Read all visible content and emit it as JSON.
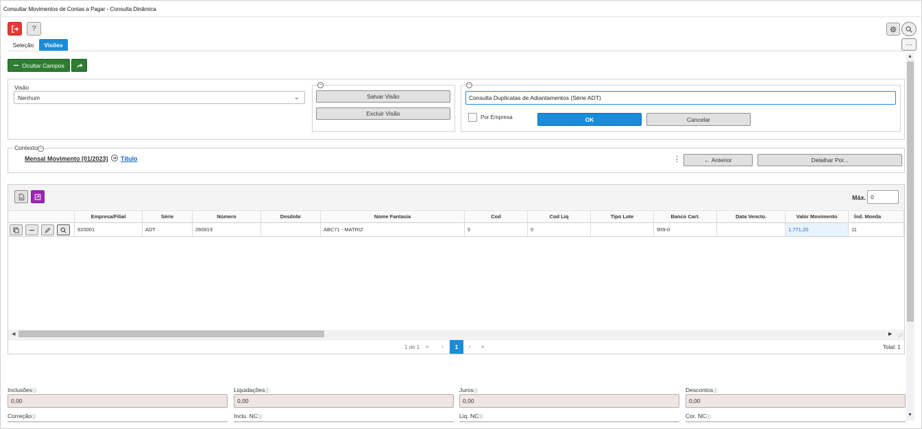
{
  "window": {
    "title": "Consultar Movimentos de Contas a Pagar - Consulta Dinâmica"
  },
  "toolbar": {
    "help": "?",
    "more": "···"
  },
  "tabs": [
    {
      "label": "Seleção"
    },
    {
      "label": "Visões"
    }
  ],
  "actions": {
    "hide_fields": "Ocultar Campos"
  },
  "visao": {
    "label": "Visão",
    "selected": "Nenhum",
    "save": "Salvar Visão",
    "delete": "Excluir Visão",
    "name_value": "Consulta Duplicatas de Adiantamentos (Série ADT)",
    "per_company": "Por Empresa",
    "ok": "OK",
    "cancel": "Cancelar"
  },
  "context": {
    "label": "Contexto",
    "main": "Mensal Movimento [01/2023]",
    "link": "Título",
    "previous": "Anterior",
    "detail": "Detalhar Por..."
  },
  "grid": {
    "max_label": "Máx.",
    "max_value": "0",
    "columns": [
      "Empresa/Filial",
      "Série",
      "Número",
      "Desdobr",
      "Nome Fantasia",
      "Cod",
      "Cod Liq",
      "Tipo Lote",
      "Banco Cart.",
      "Data Vencto.",
      "Valor Movimento",
      "Índ. Moeda"
    ],
    "rows": [
      [
        "920001",
        "ADT",
        "260919",
        "",
        "ABC71 - MATRIZ",
        "5",
        "0",
        "",
        "909-0",
        "",
        "1.771,20",
        "11"
      ]
    ]
  },
  "pager": {
    "info": "1 de 1",
    "current": "1",
    "total": "Total: 1"
  },
  "totals": [
    {
      "label": "Inclusões",
      "value": "0,00"
    },
    {
      "label": "Liquidações",
      "value": "0,00"
    },
    {
      "label": "Juros",
      "value": "0,00"
    },
    {
      "label": "Descontos",
      "value": "0,00"
    },
    {
      "label": "Correção",
      "value": ""
    },
    {
      "label": "Inclu. NC",
      "value": ""
    },
    {
      "label": "Liq. NC",
      "value": ""
    },
    {
      "label": "Cor. NC",
      "value": ""
    }
  ],
  "colors": {
    "accent": "#1a8cd8",
    "success": "#2e7d32",
    "danger": "#e53935",
    "purple": "#9c27b0"
  }
}
